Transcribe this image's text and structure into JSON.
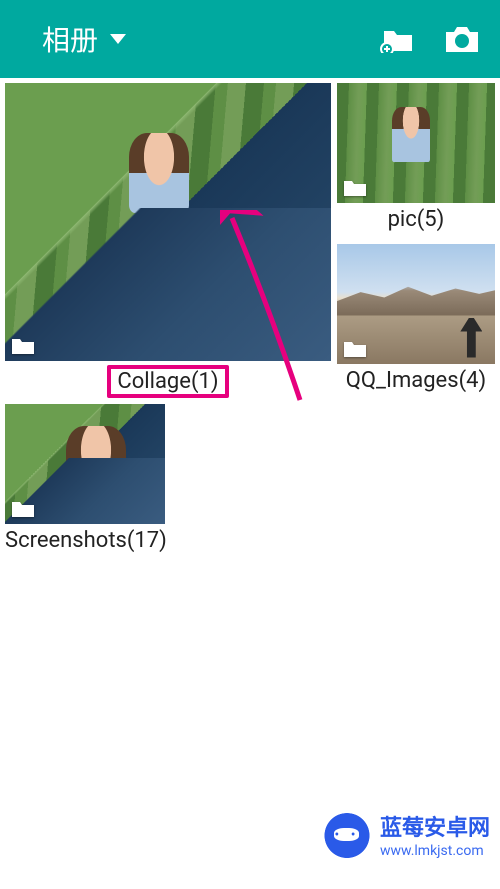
{
  "header": {
    "title": "相册",
    "icons": {
      "dropdown": "chevron-down",
      "add_folder": "folder-add",
      "camera": "camera"
    }
  },
  "albums": [
    {
      "name": "Collage",
      "count": 1,
      "label": "Collage(1)",
      "size": "large",
      "highlighted": true,
      "thumb_style": "bamboo-collage"
    },
    {
      "name": "pic",
      "count": 5,
      "label": "pic(5)",
      "size": "small",
      "highlighted": false,
      "thumb_style": "bamboo-small"
    },
    {
      "name": "QQ_Images",
      "count": 4,
      "label": "QQ_Images(4)",
      "size": "small",
      "highlighted": false,
      "thumb_style": "mountain"
    },
    {
      "name": "Screenshots",
      "count": 17,
      "label": "Screenshots(17)",
      "size": "small",
      "highlighted": false,
      "thumb_style": "bamboo-collage"
    }
  ],
  "annotation": {
    "arrow_color": "#e6007e"
  },
  "watermark": {
    "title": "蓝莓安卓网",
    "url": "www.lmkjst.com"
  }
}
